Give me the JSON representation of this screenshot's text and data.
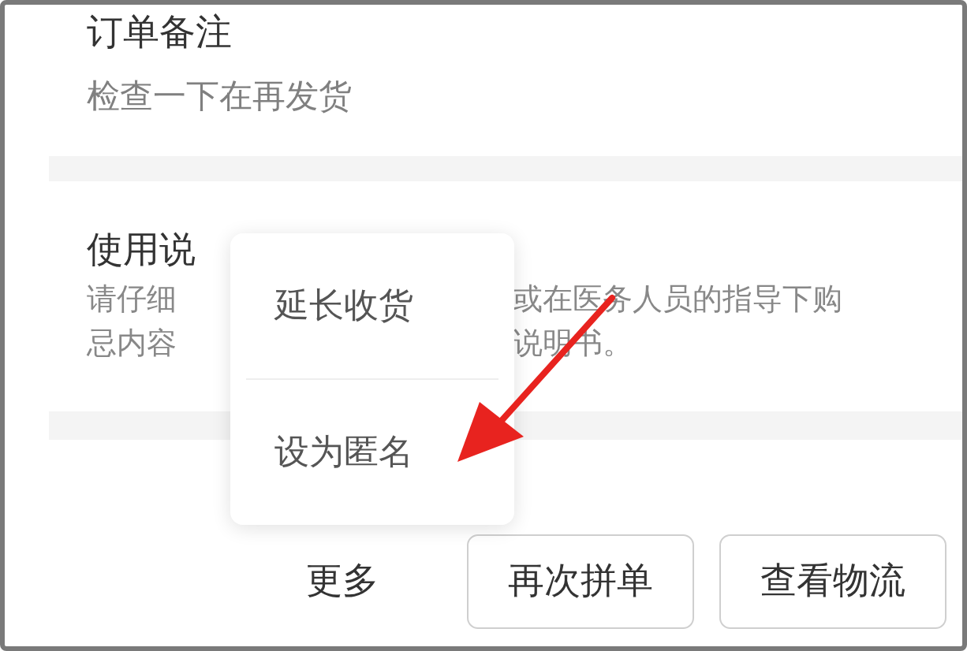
{
  "remark_section": {
    "title": "订单备注",
    "text": "检查一下在再发货"
  },
  "usage_section": {
    "title": "使用说",
    "lines": [
      {
        "left": "请仔细",
        "right": "或在医务人员的指导下购"
      },
      {
        "left": "忌内容",
        "right": "说明书。"
      }
    ]
  },
  "popup_menu": {
    "items": [
      "延长收货",
      "设为匿名"
    ]
  },
  "bottom_bar": {
    "more": "更多",
    "buttons": [
      "再次拼单",
      "查看物流"
    ]
  }
}
